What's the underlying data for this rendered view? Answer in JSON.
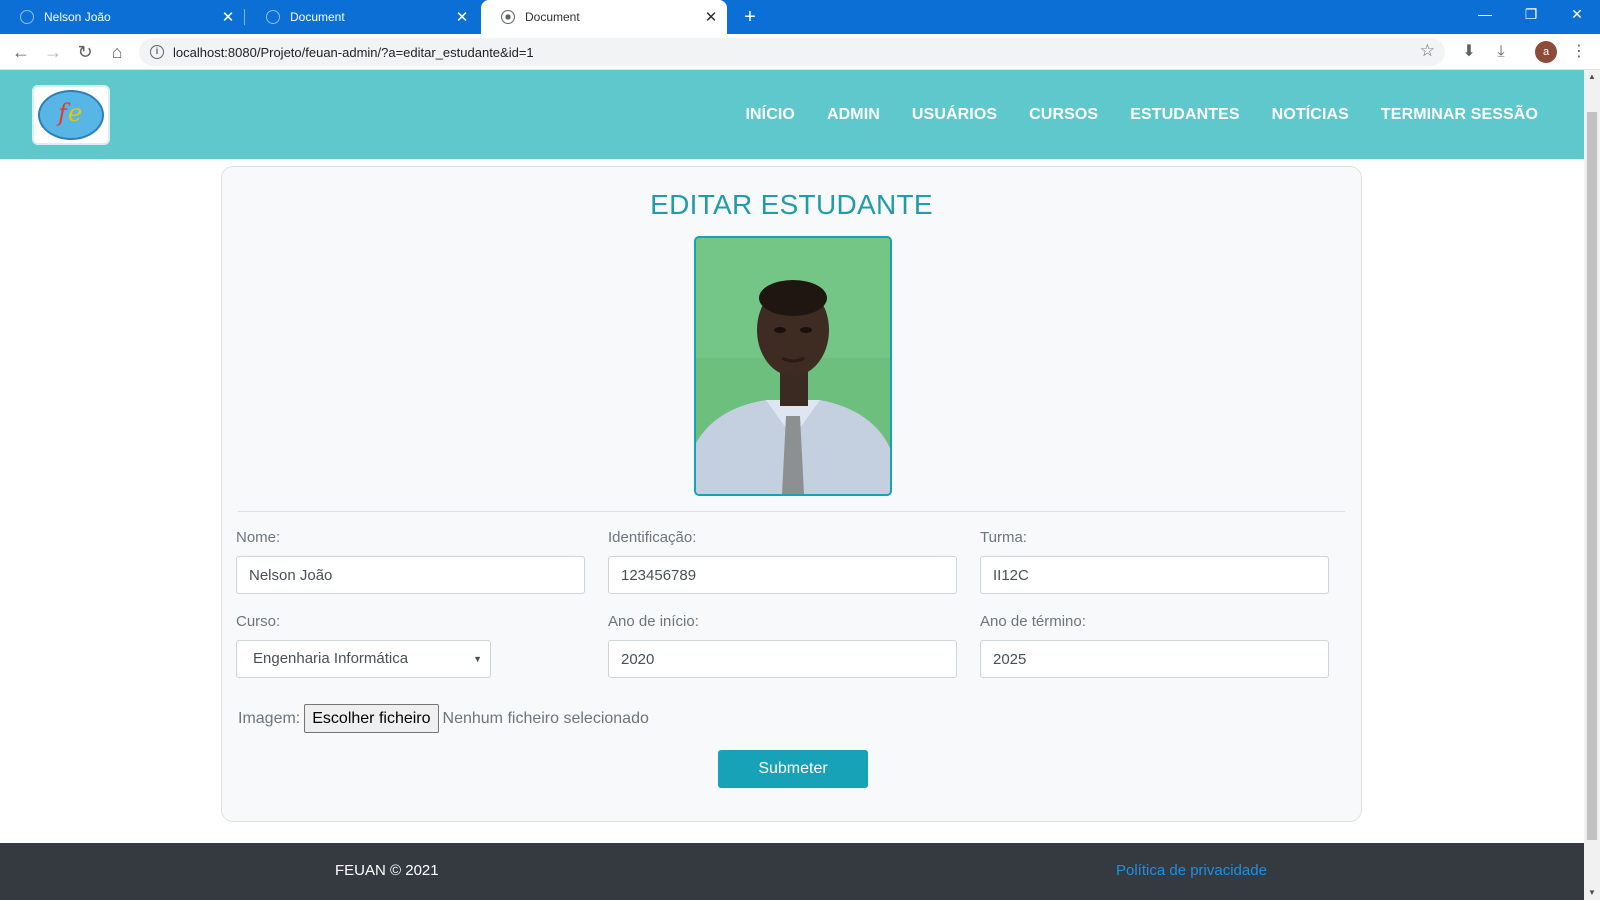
{
  "browser": {
    "tabs": [
      {
        "title": "Nelson João"
      },
      {
        "title": "Document"
      },
      {
        "title": "Document"
      }
    ],
    "url": "localhost:8080/Projeto/feuan-admin/?a=editar_estudante&id=1",
    "profile_initial": "a"
  },
  "header": {
    "nav": [
      "INÍCIO",
      "ADMIN",
      "USUÁRIOS",
      "CURSOS",
      "ESTUDANTES",
      "NOTÍCIAS",
      "TERMINAR SESSÃO"
    ]
  },
  "form": {
    "title": "EDITAR ESTUDANTE",
    "nome": {
      "label": "Nome:",
      "value": "Nelson João"
    },
    "identificacao": {
      "label": "Identificação:",
      "value": "123456789"
    },
    "turma": {
      "label": "Turma:",
      "value": "II12C"
    },
    "curso": {
      "label": "Curso:",
      "value": "Engenharia Informática"
    },
    "ano_inicio": {
      "label": "Ano de início:",
      "value": "2020"
    },
    "ano_termino": {
      "label": "Ano de término:",
      "value": "2025"
    },
    "imagem": {
      "label": "Imagem:",
      "button": "Escolher ficheiro",
      "status": "Nenhum ficheiro selecionado"
    },
    "submit_label": "Submeter"
  },
  "footer": {
    "copyright": "FEUAN © 2021",
    "privacy_link": "Política de privacidade"
  },
  "colors": {
    "tab_bar": "#0b6fd6",
    "header": "#5fc8cc",
    "accent": "#17a2b8",
    "title": "#239aa8",
    "footer": "#343a40",
    "link": "#1e90e0"
  }
}
